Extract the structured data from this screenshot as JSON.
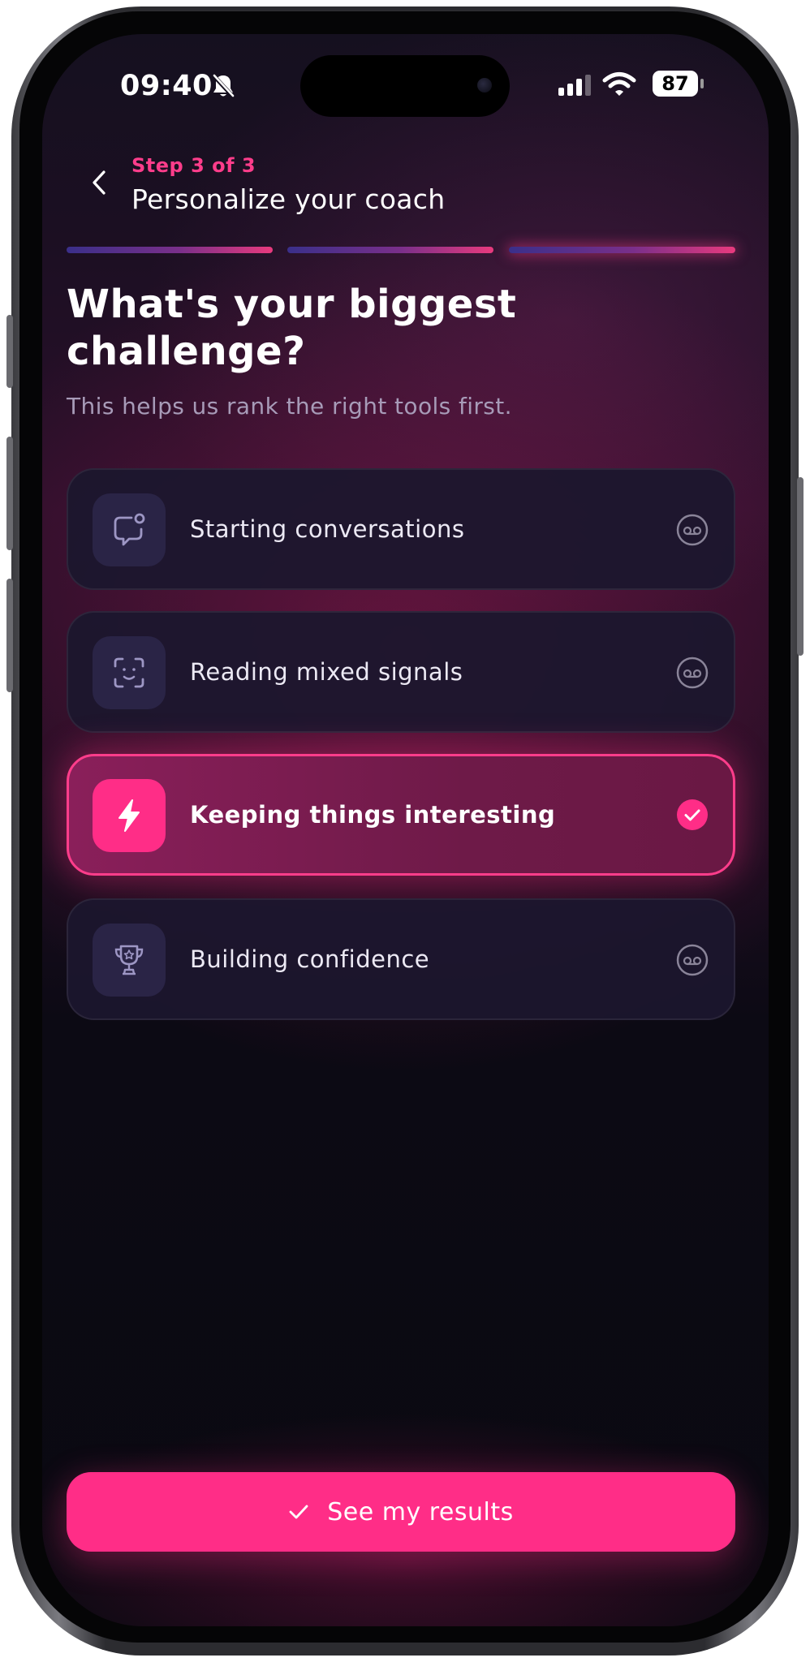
{
  "status_bar": {
    "time": "09:40",
    "battery": "87",
    "icons": [
      "bell-slash-icon",
      "cellular-signal-icon",
      "wifi-icon",
      "battery-icon"
    ]
  },
  "header": {
    "step": "Step 3 of 3",
    "title": "Personalize your coach",
    "progress_steps_total": 3,
    "progress_current_step": 3
  },
  "question": {
    "title": "What's your biggest challenge?",
    "subtitle": "This helps us rank the right tools first."
  },
  "options": [
    {
      "label": "Starting conversations",
      "icon": "chat-bubble-icon",
      "selected": false
    },
    {
      "label": "Reading mixed signals",
      "icon": "face-scan-icon",
      "selected": false
    },
    {
      "label": "Keeping things interesting",
      "icon": "lightning-bolt-icon",
      "selected": true
    },
    {
      "label": "Building confidence",
      "icon": "trophy-icon",
      "selected": false
    }
  ],
  "cta": {
    "label": "See my results",
    "icon": "check-icon"
  },
  "colors": {
    "accent": "#ff2d87",
    "accent_text": "#ff3d8b",
    "card_bg": "#1c162e",
    "icon_tile": "#2a2446",
    "subtitle": "#a79bb8"
  }
}
